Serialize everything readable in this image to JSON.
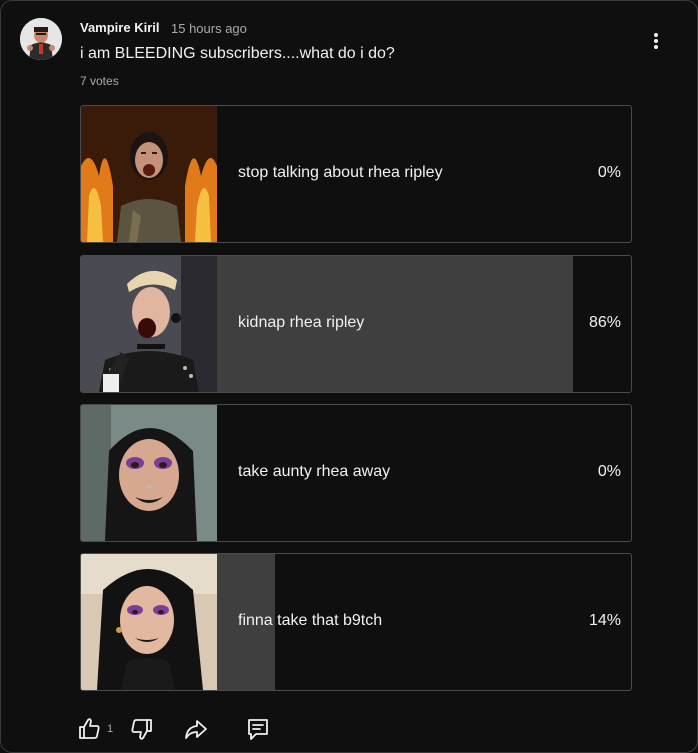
{
  "post": {
    "author": "Vampire Kiril",
    "time": "15 hours ago",
    "question": "i am BLEEDING subscribers....what do i do?",
    "votes": "7 votes"
  },
  "poll": {
    "options": [
      {
        "label": "stop talking about rhea ripley",
        "percent_label": "0%",
        "percent": 0
      },
      {
        "label": "kidnap rhea ripley",
        "percent_label": "86%",
        "percent": 86
      },
      {
        "label": "take aunty rhea away",
        "percent_label": "0%",
        "percent": 0
      },
      {
        "label": "finna take that b9tch",
        "percent_label": "14%",
        "percent": 14
      }
    ]
  },
  "actions": {
    "like_count": "1"
  },
  "colors": {
    "background": "#0f0f0f",
    "fill": "#3f3f3f",
    "border": "#4a4a4a",
    "text": "#f1f1f1",
    "muted": "#aaaaaa"
  },
  "icons": [
    "more-vert-icon",
    "thumbs-up-icon",
    "thumbs-down-icon",
    "share-icon",
    "comment-icon"
  ]
}
